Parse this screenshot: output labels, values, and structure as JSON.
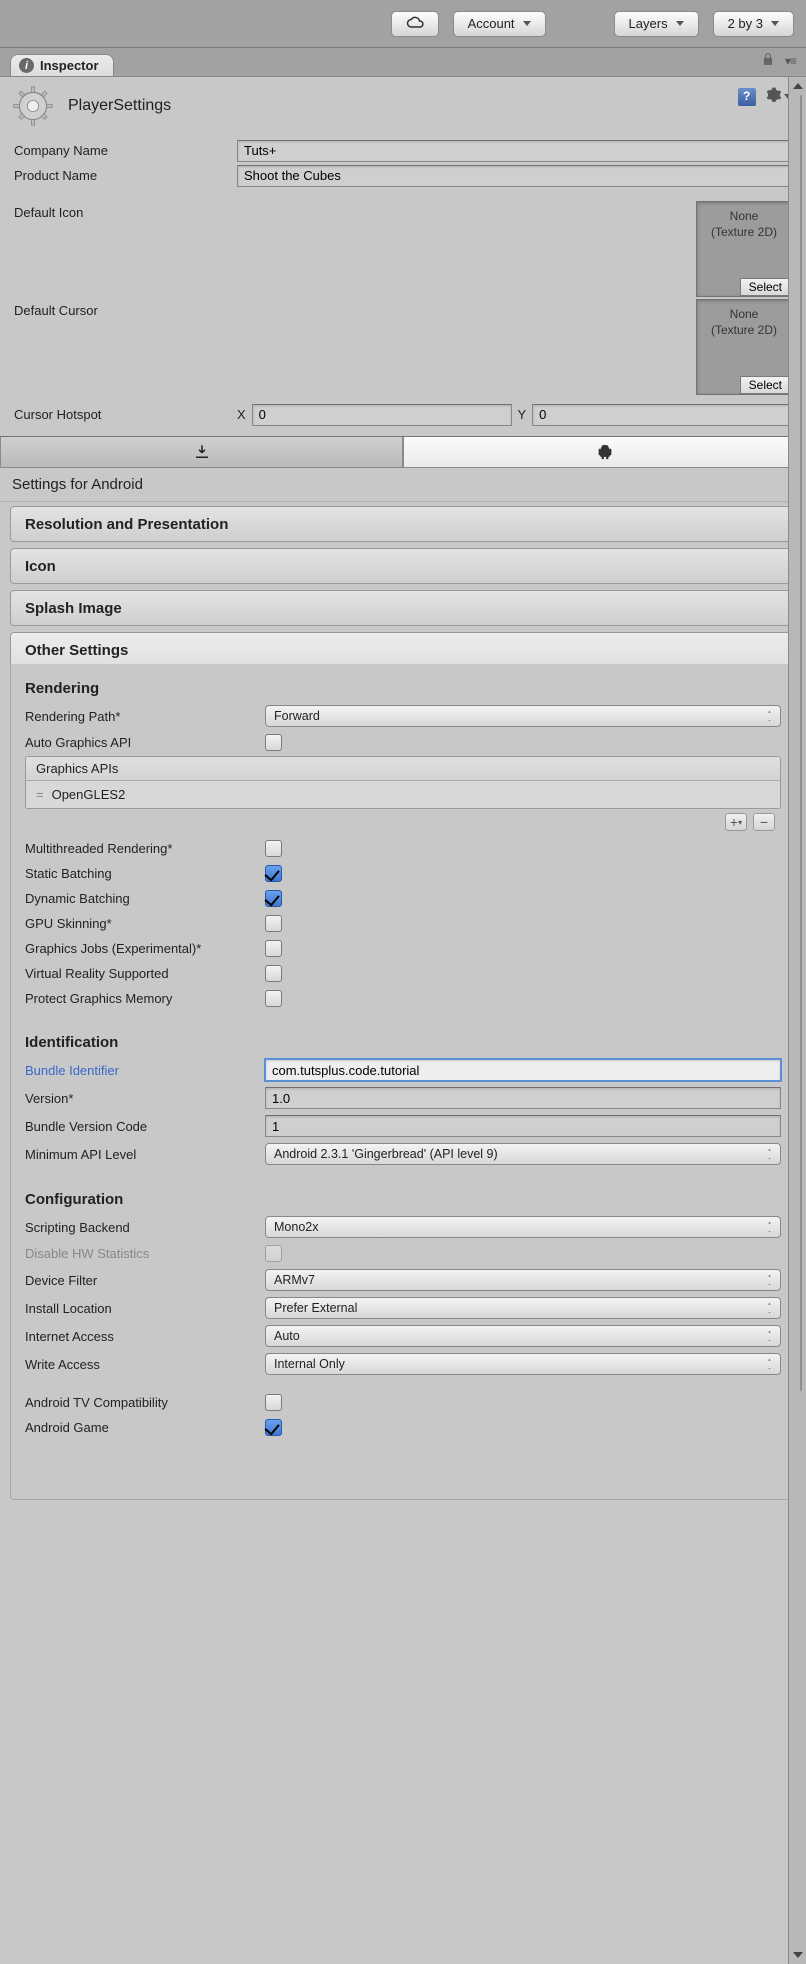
{
  "toolbar": {
    "account": "Account",
    "layers": "Layers",
    "layout": "2 by 3"
  },
  "tab": {
    "label": "Inspector"
  },
  "header": {
    "title": "PlayerSettings"
  },
  "fields": {
    "company_name_label": "Company Name",
    "company_name": "Tuts+",
    "product_name_label": "Product Name",
    "product_name": "Shoot the Cubes",
    "default_icon_label": "Default Icon",
    "default_cursor_label": "Default Cursor",
    "cursor_hotspot_label": "Cursor Hotspot",
    "cursor_x": "0",
    "cursor_y": "0",
    "obj_none": "None",
    "obj_type": "(Texture 2D)",
    "obj_select": "Select"
  },
  "platform_label": "Settings for Android",
  "folds": {
    "res": "Resolution and Presentation",
    "icon": "Icon",
    "splash": "Splash Image",
    "other": "Other Settings"
  },
  "rendering": {
    "title": "Rendering",
    "path_label": "Rendering Path*",
    "path_value": "Forward",
    "auto_api_label": "Auto Graphics API",
    "apis_label": "Graphics APIs",
    "api_item": "OpenGLES2",
    "mt_label": "Multithreaded Rendering*",
    "static_label": "Static Batching",
    "dynamic_label": "Dynamic Batching",
    "gpu_label": "GPU Skinning*",
    "jobs_label": "Graphics Jobs (Experimental)*",
    "vr_label": "Virtual Reality Supported",
    "protect_label": "Protect Graphics Memory"
  },
  "ident": {
    "title": "Identification",
    "bundle_label": "Bundle Identifier",
    "bundle_value": "com.tutsplus.code.tutorial",
    "version_label": "Version*",
    "version_value": "1.0",
    "bvc_label": "Bundle Version Code",
    "bvc_value": "1",
    "min_api_label": "Minimum API Level",
    "min_api_value": "Android 2.3.1 'Gingerbread' (API level 9)"
  },
  "config": {
    "title": "Configuration",
    "scripting_label": "Scripting Backend",
    "scripting_value": "Mono2x",
    "disable_hw_label": "Disable HW Statistics",
    "device_filter_label": "Device Filter",
    "device_filter_value": "ARMv7",
    "install_loc_label": "Install Location",
    "install_loc_value": "Prefer External",
    "internet_label": "Internet Access",
    "internet_value": "Auto",
    "write_label": "Write Access",
    "write_value": "Internal Only",
    "tv_label": "Android TV Compatibility",
    "game_label": "Android Game"
  }
}
